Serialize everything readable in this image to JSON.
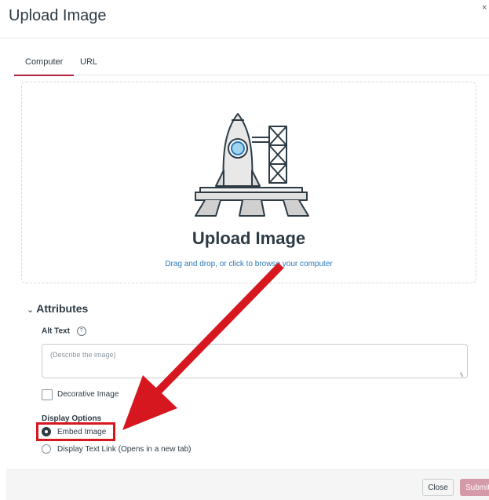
{
  "dialog": {
    "title": "Upload Image",
    "close_glyph": "×"
  },
  "tabs": [
    {
      "label": "Computer",
      "active": true
    },
    {
      "label": "URL",
      "active": false
    }
  ],
  "dropzone": {
    "icon": "rocket-launch-icon",
    "title": "Upload Image",
    "subtitle": "Drag and drop, or click to browse your computer"
  },
  "attributes": {
    "heading": "Attributes",
    "alt_text_label": "Alt Text",
    "alt_text_value": "",
    "alt_text_placeholder": "(Describe the image)",
    "decorative_label": "Decorative Image",
    "decorative_checked": false,
    "display_options_label": "Display Options",
    "display_options": [
      {
        "label": "Embed Image",
        "selected": true
      },
      {
        "label": "Display Text Link (Opens in a new tab)",
        "selected": false
      }
    ]
  },
  "footer": {
    "close_label": "Close",
    "submit_label": "Submit"
  },
  "annotation": {
    "arrow_color": "#d6171f",
    "highlight_color": "#d6171f"
  },
  "colors": {
    "accent": "#b0233f",
    "link": "#2b7abc",
    "submit_disabled": "#d49aa7",
    "text": "#2d3b45"
  }
}
